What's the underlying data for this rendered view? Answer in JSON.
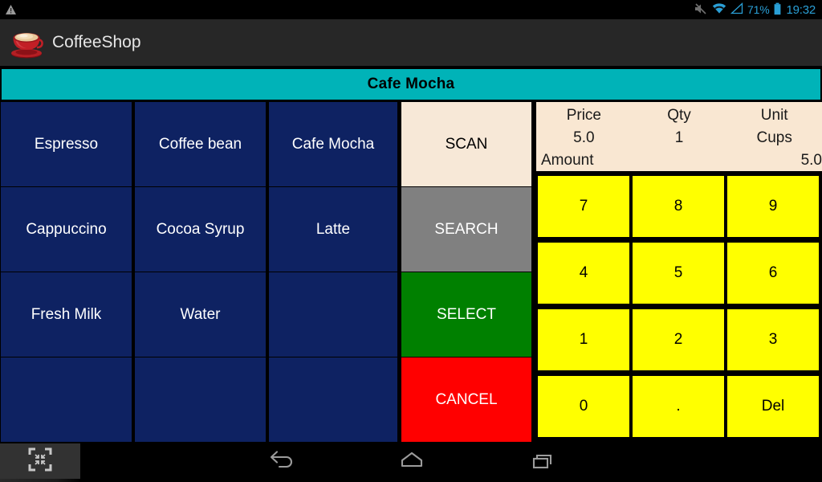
{
  "statusbar": {
    "warning_icon": "warning-triangle-icon",
    "mute_icon": "volume-muted-icon",
    "wifi_icon": "wifi-icon",
    "signal_icon": "cell-signal-icon",
    "battery_percent": "71%",
    "battery_icon": "battery-icon",
    "clock": "19:32",
    "accent_color": "#2a9fd6"
  },
  "appbar": {
    "logo_icon": "coffee-cup-icon",
    "title": "CoffeeShop",
    "background_color": "#272727"
  },
  "product_banner": {
    "title": "Cafe Mocha",
    "background_color": "#00b3b8"
  },
  "product_grid": {
    "tile_color": "#0e2262",
    "rows": [
      [
        "Espresso",
        "Coffee bean",
        "Cafe Mocha"
      ],
      [
        "Cappuccino",
        "Cocoa Syrup",
        "Latte"
      ],
      [
        "Fresh Milk",
        "Water",
        ""
      ],
      [
        "",
        "",
        ""
      ]
    ]
  },
  "actions": [
    {
      "label": "SCAN",
      "bg": "#f7e8d7",
      "fg": "#000000"
    },
    {
      "label": "SEARCH",
      "bg": "#808080",
      "fg": "#ffffff"
    },
    {
      "label": "SELECT",
      "bg": "#008000",
      "fg": "#ffffff"
    },
    {
      "label": "CANCEL",
      "bg": "#ff0000",
      "fg": "#ffffff"
    }
  ],
  "info_panel": {
    "background_color": "#f9e7d2",
    "headers": [
      "Price",
      "Qty",
      "Unit"
    ],
    "values": [
      "5.0",
      "1",
      "Cups"
    ],
    "amount_label": "Amount",
    "amount_value": "5.0"
  },
  "keypad": {
    "key_color": "#ffff00",
    "text_color": "#000000",
    "rows": [
      [
        "7",
        "8",
        "9"
      ],
      [
        "4",
        "5",
        "6"
      ],
      [
        "1",
        "2",
        "3"
      ],
      [
        "0",
        ".",
        "Del"
      ]
    ]
  },
  "navbar": {
    "scan_icon": "scan-frame-icon",
    "back_icon": "back-arrow-icon",
    "home_icon": "home-icon",
    "recents_icon": "recent-apps-icon"
  }
}
